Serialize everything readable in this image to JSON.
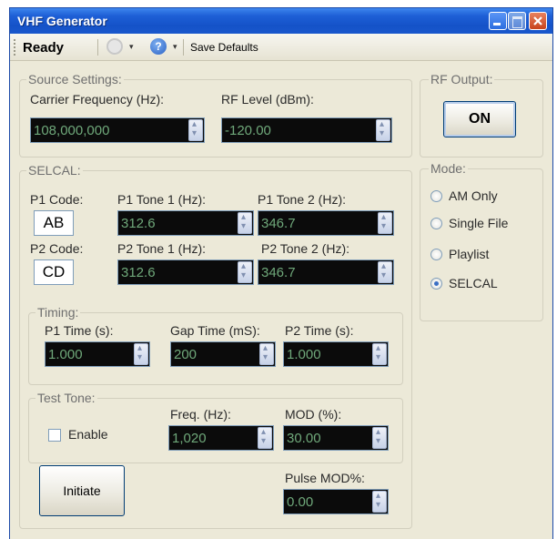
{
  "window": {
    "title": "VHF Generator"
  },
  "toolbar": {
    "status": "Ready",
    "gear_icon": "gear-icon",
    "help_icon": "help-icon",
    "help_glyph": "?",
    "dropdown_glyph": "▾",
    "save_defaults_label": "Save Defaults"
  },
  "source_settings": {
    "legend": "Source Settings:",
    "carrier_frequency": {
      "label": "Carrier Frequency (Hz):",
      "value": "108,000,000"
    },
    "rf_level": {
      "label": "RF Level (dBm):",
      "value": "-120.00"
    }
  },
  "rf_output": {
    "legend": "RF Output:",
    "button_label": "ON"
  },
  "mode": {
    "legend": "Mode:",
    "options": [
      {
        "label": "AM Only",
        "selected": false
      },
      {
        "label": "Single File",
        "selected": false
      },
      {
        "label": "Playlist",
        "selected": false
      },
      {
        "label": "SELCAL",
        "selected": true
      }
    ]
  },
  "selcal": {
    "legend": "SELCAL:",
    "p1": {
      "code_label": "P1 Code:",
      "code": "AB",
      "tone1_label": "P1 Tone 1 (Hz):",
      "tone1": "312.6",
      "tone2_label": "P1 Tone 2 (Hz):",
      "tone2": "346.7"
    },
    "p2": {
      "code_label": "P2 Code:",
      "code": "CD",
      "tone1_label": "P2 Tone 1 (Hz):",
      "tone1": "312.6",
      "tone2_label": "P2 Tone 2 (Hz):",
      "tone2": "346.7"
    },
    "timing": {
      "legend": "Timing:",
      "p1_time": {
        "label": "P1 Time (s):",
        "value": "1.000"
      },
      "gap_time": {
        "label": "Gap Time (mS):",
        "value": "200"
      },
      "p2_time": {
        "label": "P2 Time (s):",
        "value": "1.000"
      }
    },
    "test_tone": {
      "legend": "Test Tone:",
      "enable_label": "Enable",
      "enabled": false,
      "freq": {
        "label": "Freq. (Hz):",
        "value": "1,020"
      },
      "mod": {
        "label": "MOD (%):",
        "value": "30.00"
      }
    },
    "pulse_mod": {
      "label": "Pulse MOD%:",
      "value": "0.00"
    },
    "initiate_label": "Initiate"
  },
  "colors": {
    "title_bar": "#1452c8",
    "window_bg": "#ece9d8",
    "field_bg": "#0b0b0b",
    "field_text": "#6fa87a",
    "close_button": "#c8431c"
  }
}
